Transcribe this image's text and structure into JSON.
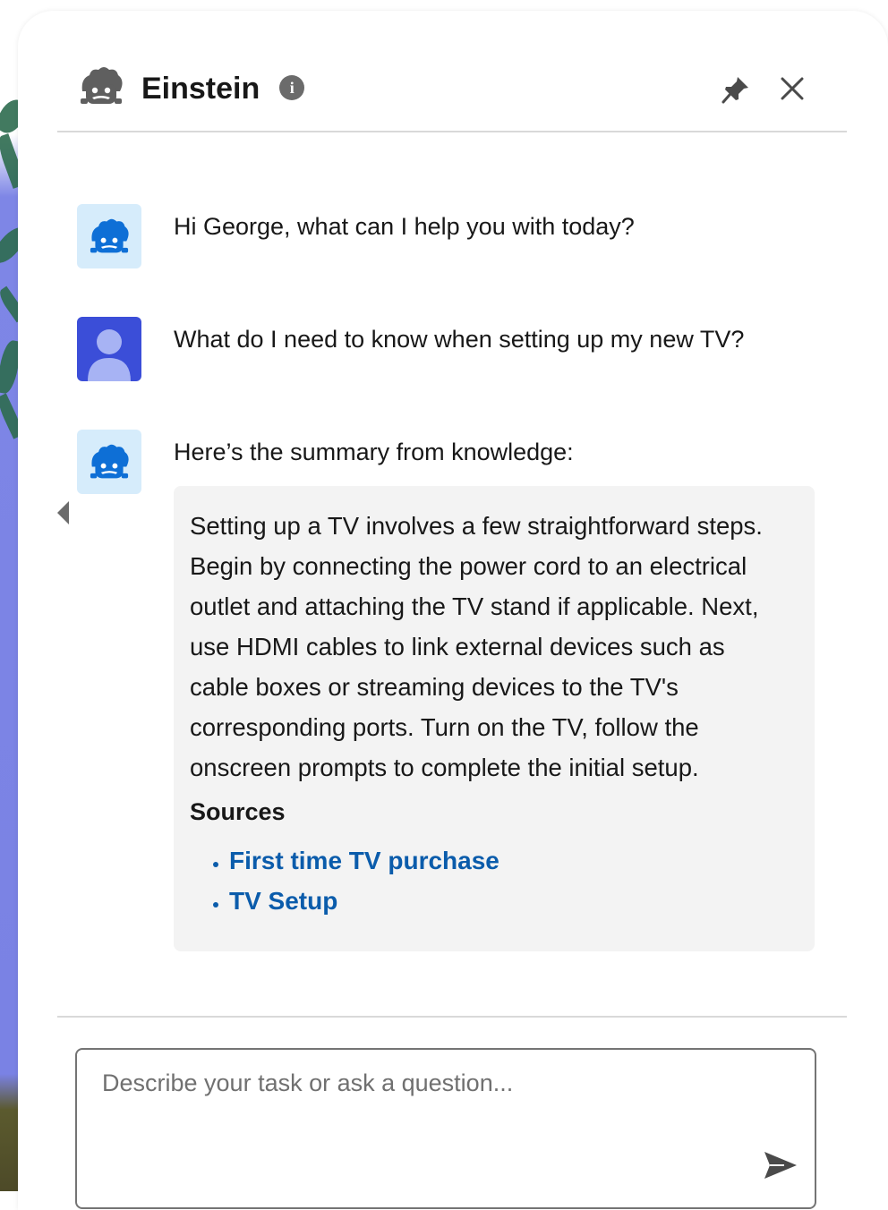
{
  "header": {
    "title": "Einstein",
    "info_icon_glyph": "i"
  },
  "messages": [
    {
      "role": "assistant",
      "text": "Hi George, what can I help you with today?"
    },
    {
      "role": "user",
      "text": "What do I need to know when setting up my new TV?"
    },
    {
      "role": "assistant",
      "text": "Here’s the summary from knowledge:"
    }
  ],
  "summary": {
    "body": "Setting up a TV involves a few straightforward steps.\nBegin by connecting the power cord to an electrical\noutlet and attaching the TV stand if applicable. Next,\nuse HDMI cables to link external devices such as\ncable boxes or streaming devices to the TV's\ncorresponding ports. Turn on the TV, follow the\nonscreen prompts to complete the initial setup.",
    "sources_title": "Sources",
    "sources": [
      "First time TV purchase",
      "TV Setup"
    ]
  },
  "composer": {
    "placeholder": "Describe your task or ask a question..."
  },
  "icons": {
    "logo": "einstein-icon",
    "info": "info-icon",
    "pin": "pin-icon",
    "close": "close-icon",
    "send": "send-icon",
    "collapse": "chevron-left-icon"
  },
  "colors": {
    "link": "#0b5cab",
    "bot_avatar_bg": "#d6ecfb",
    "user_avatar_bg": "#3b4ed8",
    "summary_bg": "#f3f3f3"
  }
}
